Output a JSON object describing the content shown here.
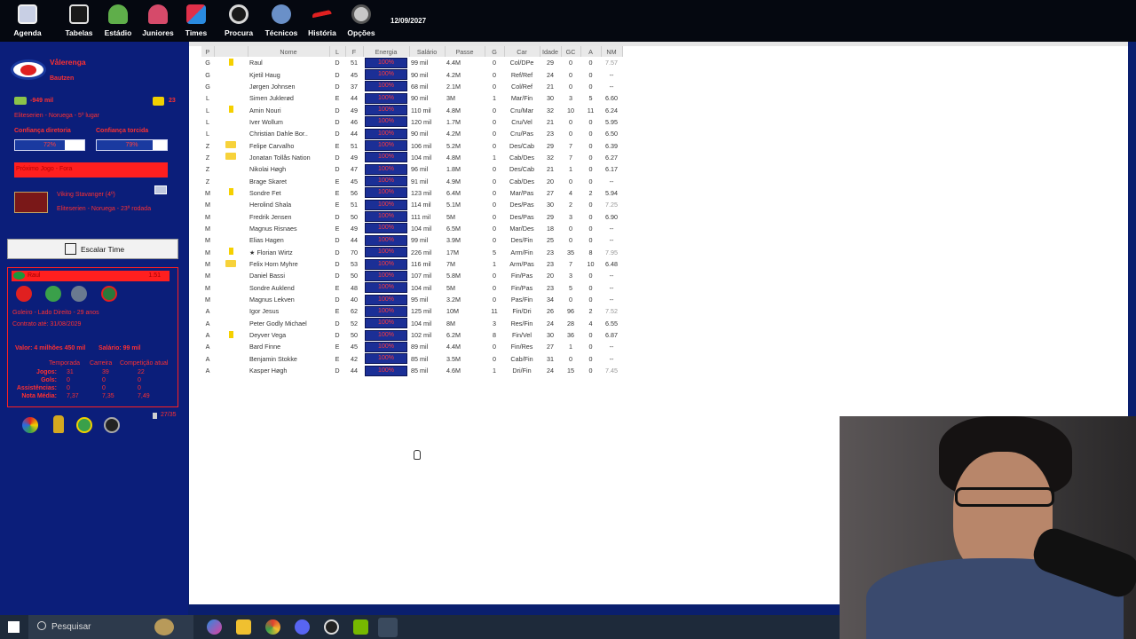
{
  "menu": [
    {
      "label": "Agenda",
      "icon": "calendar-icon",
      "color": "#d0d6e8"
    },
    {
      "label": "Tabelas",
      "icon": "table-icon",
      "color": "#e0e0e0"
    },
    {
      "label": "Estádio",
      "icon": "stadium-icon",
      "color": "#5fae4a"
    },
    {
      "label": "Juniores",
      "icon": "junior-player-icon",
      "color": "#d64a6a"
    },
    {
      "label": "Times",
      "icon": "jersey-icon",
      "color": "#e0304a"
    },
    {
      "label": "Procura",
      "icon": "magnifier-icon",
      "color": "#d8d8d8"
    },
    {
      "label": "Técnicos",
      "icon": "coach-icon",
      "color": "#6a90c8"
    },
    {
      "label": "História",
      "icon": "history-icon",
      "color": "#e02020"
    },
    {
      "label": "Opções",
      "icon": "options-icon",
      "color": "#c8c8c8"
    }
  ],
  "date": "12/09/2027",
  "club": {
    "name": "Vålerenga",
    "manager": "Bautzen",
    "money": "-949 mil",
    "messages": "23",
    "league": "Eliteserien - Noruega - 5º lugar",
    "conf_board_label": "Confiança diretoria",
    "conf_fans_label": "Confiança torcida",
    "conf_board": "72%",
    "conf_fans": "79%",
    "conf_board_value": 0.72,
    "conf_fans_value": 0.79,
    "next_game_label": "Próximo Jogo - Fora",
    "opponent": "Viking Stavanger (4º)",
    "opponent_info": "Eliteserien - Noruega - 23ª rodada"
  },
  "escalar_label": "Escalar Time",
  "player_card": {
    "name": "Raul",
    "rating": "1.51",
    "position": "Goleiro - Lado Direito - 29 anos",
    "contract": "Contrato até: 31/08/2029",
    "value": "Valor: 4 milhões 450 mil",
    "salary": "Salário: 99 mil",
    "col_headers": [
      "Temporada",
      "Carreira",
      "Competição atual"
    ],
    "rows": [
      {
        "label": "Jogos:",
        "vals": [
          "31",
          "39",
          "22"
        ]
      },
      {
        "label": "Gols:",
        "vals": [
          "0",
          "0",
          "0"
        ]
      },
      {
        "label": "Assistências:",
        "vals": [
          "0",
          "0",
          "0"
        ]
      },
      {
        "label": "Nota Média:",
        "vals": [
          "7,37",
          "7,35",
          "7,49"
        ]
      }
    ]
  },
  "squad_count": "27/35",
  "table": {
    "headers": [
      "P",
      "",
      "Nome",
      "L",
      "F",
      "Energia",
      "Salário",
      "Passe",
      "G",
      "Car",
      "Idade",
      "GC",
      "A",
      "NM"
    ],
    "rows": [
      [
        "G",
        "y",
        "Raul",
        "D",
        "51",
        "100%",
        "99 mil",
        "4.4M",
        "0",
        "Col/DPe",
        "29",
        "0",
        "0",
        "7.57"
      ],
      [
        "G",
        "",
        "Kjetil Haug",
        "D",
        "45",
        "100%",
        "90 mil",
        "4.2M",
        "0",
        "Ref/Ref",
        "24",
        "0",
        "0",
        "--"
      ],
      [
        "G",
        "",
        "Jørgen Johnsen",
        "D",
        "37",
        "100%",
        "68 mil",
        "2.1M",
        "0",
        "Col/Ref",
        "21",
        "0",
        "0",
        "--"
      ],
      [
        "L",
        "",
        "Simen Juklerød",
        "E",
        "44",
        "100%",
        "90 mil",
        "3M",
        "1",
        "Mar/Fin",
        "30",
        "3",
        "5",
        "6.60"
      ],
      [
        "L",
        "y",
        "Amin Nouri",
        "D",
        "49",
        "100%",
        "110 mil",
        "4.8M",
        "0",
        "Cru/Mar",
        "32",
        "10",
        "11",
        "6.24"
      ],
      [
        "L",
        "",
        "Iver Wollum",
        "D",
        "46",
        "100%",
        "120 mil",
        "1.7M",
        "0",
        "Cru/Vel",
        "21",
        "0",
        "0",
        "5.95"
      ],
      [
        "L",
        "",
        "Christian Dahle Bor..",
        "D",
        "44",
        "100%",
        "90 mil",
        "4.2M",
        "0",
        "Cru/Pas",
        "23",
        "0",
        "0",
        "6.50"
      ],
      [
        "Z",
        "f",
        "Felipe Carvalho",
        "E",
        "51",
        "100%",
        "106 mil",
        "5.2M",
        "0",
        "Des/Cab",
        "29",
        "7",
        "0",
        "6.39"
      ],
      [
        "Z",
        "f",
        "Jonatan Tollås Nation",
        "D",
        "49",
        "100%",
        "104 mil",
        "4.8M",
        "1",
        "Cab/Des",
        "32",
        "7",
        "0",
        "6.27"
      ],
      [
        "Z",
        "",
        "Nikolai Høgh",
        "D",
        "47",
        "100%",
        "96 mil",
        "1.8M",
        "0",
        "Des/Cab",
        "21",
        "1",
        "0",
        "6.17"
      ],
      [
        "Z",
        "",
        "Brage Skaret",
        "E",
        "45",
        "100%",
        "91 mil",
        "4.9M",
        "0",
        "Cab/Des",
        "20",
        "0",
        "0",
        "--"
      ],
      [
        "M",
        "y",
        "Sondre Fet",
        "E",
        "56",
        "100%",
        "123 mil",
        "6.4M",
        "0",
        "Mar/Pas",
        "27",
        "4",
        "2",
        "5.94"
      ],
      [
        "M",
        "",
        "Herolind Shala",
        "E",
        "51",
        "100%",
        "114 mil",
        "5.1M",
        "0",
        "Des/Pas",
        "30",
        "2",
        "0",
        "7.25"
      ],
      [
        "M",
        "",
        "Fredrik Jensen",
        "D",
        "50",
        "100%",
        "111 mil",
        "5M",
        "0",
        "Des/Pas",
        "29",
        "3",
        "0",
        "6.90"
      ],
      [
        "M",
        "",
        "Magnus Risnaes",
        "E",
        "49",
        "100%",
        "104 mil",
        "6.5M",
        "0",
        "Mar/Des",
        "18",
        "0",
        "0",
        "--"
      ],
      [
        "M",
        "",
        "Elias Hagen",
        "D",
        "44",
        "100%",
        "99 mil",
        "3.9M",
        "0",
        "Des/Fin",
        "25",
        "0",
        "0",
        "--"
      ],
      [
        "M",
        "y",
        "★ Florian Wirtz",
        "D",
        "70",
        "100%",
        "226 mil",
        "17M",
        "5",
        "Arm/Fin",
        "23",
        "35",
        "8",
        "7.95"
      ],
      [
        "M",
        "f",
        "Felix Horn Myhre",
        "D",
        "53",
        "100%",
        "116 mil",
        "7M",
        "1",
        "Arm/Pas",
        "23",
        "7",
        "10",
        "6.48"
      ],
      [
        "M",
        "",
        "Daniel Bassi",
        "D",
        "50",
        "100%",
        "107 mil",
        "5.8M",
        "0",
        "Fin/Pas",
        "20",
        "3",
        "0",
        "--"
      ],
      [
        "M",
        "",
        "Sondre Auklend",
        "E",
        "48",
        "100%",
        "104 mil",
        "5M",
        "0",
        "Fin/Pas",
        "23",
        "5",
        "0",
        "--"
      ],
      [
        "M",
        "",
        "Magnus Lekven",
        "D",
        "40",
        "100%",
        "95 mil",
        "3.2M",
        "0",
        "Pas/Fin",
        "34",
        "0",
        "0",
        "--"
      ],
      [
        "A",
        "",
        "Igor Jesus",
        "E",
        "62",
        "100%",
        "125 mil",
        "10M",
        "11",
        "Fin/Dri",
        "26",
        "96",
        "2",
        "7.52"
      ],
      [
        "A",
        "",
        "Peter Godly Michael",
        "D",
        "52",
        "100%",
        "104 mil",
        "8M",
        "3",
        "Res/Fin",
        "24",
        "28",
        "4",
        "6.55"
      ],
      [
        "A",
        "y",
        "Deyver Vega",
        "D",
        "50",
        "100%",
        "102 mil",
        "6.2M",
        "8",
        "Fin/Vel",
        "30",
        "36",
        "0",
        "6.87"
      ],
      [
        "A",
        "",
        "Bard Finne",
        "E",
        "45",
        "100%",
        "89 mil",
        "4.4M",
        "0",
        "Fin/Res",
        "27",
        "1",
        "0",
        "--"
      ],
      [
        "A",
        "",
        "Benjamin Stokke",
        "E",
        "42",
        "100%",
        "85 mil",
        "3.5M",
        "0",
        "Cab/Fin",
        "31",
        "0",
        "0",
        "--"
      ],
      [
        "A",
        "",
        "Kasper Høgh",
        "D",
        "44",
        "100%",
        "85 mil",
        "4.6M",
        "1",
        "Dri/Fin",
        "24",
        "15",
        "0",
        "7.45"
      ]
    ]
  },
  "taskbar": {
    "search_placeholder": "Pesquisar"
  }
}
